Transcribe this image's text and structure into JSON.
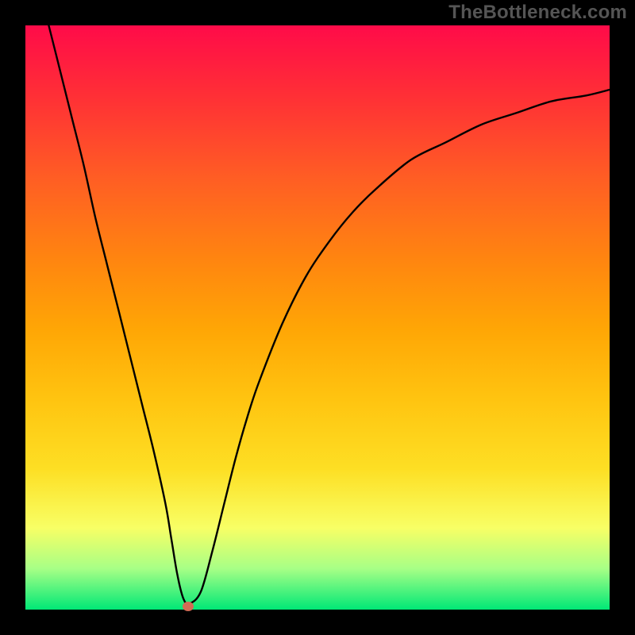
{
  "watermark": "TheBottleneck.com",
  "colors": {
    "background": "#000000",
    "gradient_top": "#ff0b49",
    "gradient_bottom": "#00e876",
    "curve": "#000000",
    "marker": "#d26b55"
  },
  "chart_data": {
    "type": "line",
    "title": "",
    "xlabel": "",
    "ylabel": "",
    "xlim": [
      0,
      100
    ],
    "ylim": [
      0,
      100
    ],
    "grid": false,
    "line": {
      "x": [
        4,
        6,
        8,
        10,
        12,
        14,
        16,
        18,
        20,
        22,
        24,
        25,
        26,
        27,
        28,
        30,
        32,
        34,
        36,
        38,
        40,
        44,
        48,
        52,
        56,
        60,
        66,
        72,
        78,
        84,
        90,
        96,
        100
      ],
      "y": [
        100,
        92,
        84,
        76,
        67,
        59,
        51,
        43,
        35,
        27,
        18,
        12,
        6,
        2,
        1,
        3,
        10,
        18,
        26,
        33,
        39,
        49,
        57,
        63,
        68,
        72,
        77,
        80,
        83,
        85,
        87,
        88,
        89
      ]
    },
    "marker": {
      "x": 27.8,
      "y": 0.6
    },
    "annotations": []
  }
}
